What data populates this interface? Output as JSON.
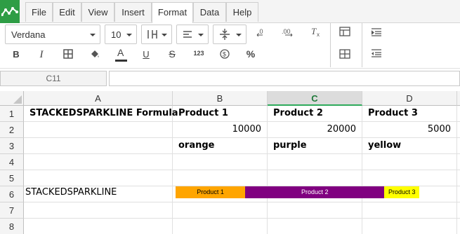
{
  "menu": {
    "items": [
      "File",
      "Edit",
      "View",
      "Insert",
      "Format",
      "Data",
      "Help"
    ],
    "active": "Format"
  },
  "toolbar": {
    "font": "Verdana",
    "size": "10",
    "icons": [
      "paint-format-icon",
      "align-left-icon",
      "vertical-align-icon",
      "decrease-decimal-icon",
      "increase-decimal-icon",
      "clear-format-icon",
      "insert-chart-icon",
      "indent-icon",
      "table-icon",
      "outdent-icon"
    ],
    "bold": "B",
    "italic": "I",
    "underline": "U",
    "strike": "S",
    "number": "123",
    "percent": "%",
    "font_color": "A"
  },
  "formula_bar": {
    "name_box": "C11",
    "value": ""
  },
  "columns": [
    "A",
    "B",
    "C",
    "D"
  ],
  "selected_column": "C",
  "rows": [
    "1",
    "2",
    "3",
    "4",
    "5",
    "6",
    "7",
    "8"
  ],
  "cells": {
    "A1": "STACKEDSPARKLINE  Formula",
    "B1": "Product 1",
    "C1": "Product 2",
    "D1": "Product 3",
    "B2": "10000",
    "C2": "20000",
    "D2": "5000",
    "B3": "orange",
    "C3": "purple",
    "D3": "yellow",
    "A6": "STACKEDSPARKLINE"
  },
  "sparkline": {
    "segments": [
      {
        "label": "Product 1",
        "value": 10000,
        "color": "#ffa500",
        "text_color": "#000"
      },
      {
        "label": "Product 2",
        "value": 20000,
        "color": "#800080",
        "text_color": "#fff"
      },
      {
        "label": "Product 3",
        "value": 5000,
        "color": "#ffff00",
        "text_color": "#000"
      }
    ]
  },
  "colors": {
    "accent": "#2e9d45",
    "selected_header_line": "#2eaa5b"
  }
}
